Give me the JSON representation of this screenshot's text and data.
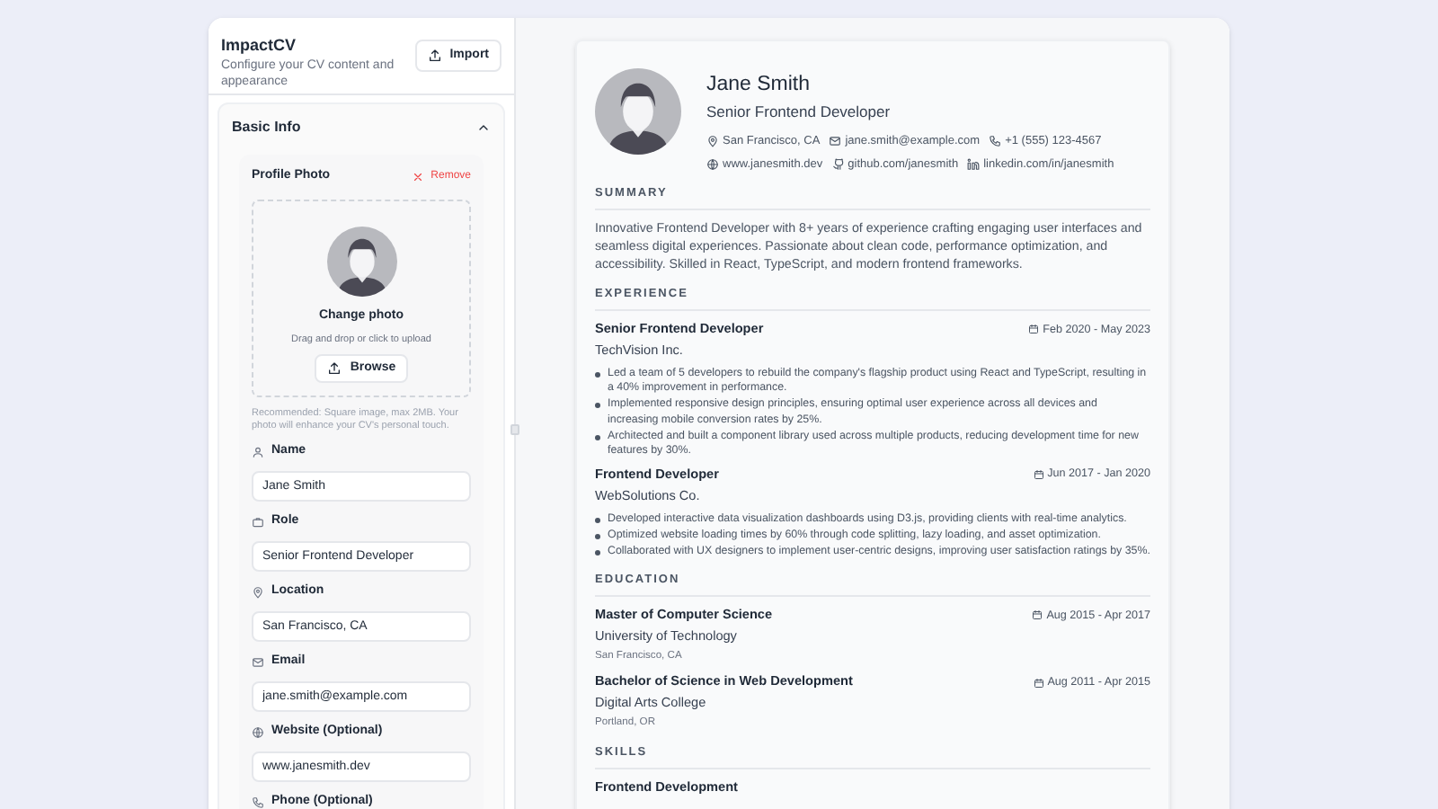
{
  "editor": {
    "title": "ImpactCV",
    "subtitle": "Configure your CV content and appearance",
    "import_button": "Import"
  },
  "basic_info": {
    "title": "Basic Info",
    "expanded": true,
    "photo": {
      "title": "Profile Photo",
      "remove": "Remove",
      "change": "Change photo",
      "hint": "Drag and drop or click to upload",
      "browse": "Browse",
      "note": "Recommended: Square image, max 2MB. Your photo will enhance your CV's personal touch."
    },
    "fields": [
      {
        "kind": "name",
        "label": "Name",
        "value": "Jane Smith"
      },
      {
        "kind": "role",
        "label": "Role",
        "value": "Senior Frontend Developer"
      },
      {
        "kind": "location",
        "label": "Location",
        "value": "San Francisco, CA"
      },
      {
        "kind": "email",
        "label": "Email",
        "value": "jane.smith@example.com"
      },
      {
        "kind": "website",
        "label": "Website (Optional)",
        "value": "www.janesmith.dev"
      },
      {
        "kind": "phone",
        "label": "Phone (Optional)"
      }
    ]
  },
  "resume": {
    "name": "Jane Smith",
    "role": "Senior Frontend Developer",
    "contacts": [
      {
        "kind": "location",
        "text": "San Francisco, CA"
      },
      {
        "kind": "email",
        "text": "jane.smith@example.com"
      },
      {
        "kind": "phone",
        "text": "+1 (555) 123-4567"
      },
      {
        "kind": "website",
        "text": "www.janesmith.dev"
      },
      {
        "kind": "github",
        "text": "github.com/janesmith"
      },
      {
        "kind": "linkedin",
        "text": "linkedin.com/in/janesmith"
      }
    ],
    "summary": {
      "heading": "SUMMARY",
      "text": "Innovative Frontend Developer with 8+ years of experience crafting engaging user interfaces and seamless digital experiences. Passionate about clean code, performance optimization, and accessibility. Skilled in React, TypeScript, and modern frontend frameworks."
    },
    "experience": {
      "heading": "EXPERIENCE",
      "items": [
        {
          "title": "Senior Frontend Developer",
          "company": "TechVision Inc.",
          "dates": "Feb 2020 - May 2023",
          "bullets": [
            "Led a team of 5 developers to rebuild the company's flagship product using React and TypeScript, resulting in a 40% improvement in performance.",
            "Implemented responsive design principles, ensuring optimal user experience across all devices and increasing mobile conversion rates by 25%.",
            "Architected and built a component library used across multiple products, reducing development time for new features by 30%."
          ]
        },
        {
          "title": "Frontend Developer",
          "company": "WebSolutions Co.",
          "dates": "Jun 2017 - Jan 2020",
          "bullets": [
            "Developed interactive data visualization dashboards using D3.js, providing clients with real-time analytics.",
            "Optimized website loading times by 60% through code splitting, lazy loading, and asset optimization.",
            "Collaborated with UX designers to implement user-centric designs, improving user satisfaction ratings by 35%."
          ]
        }
      ]
    },
    "education": {
      "heading": "EDUCATION",
      "items": [
        {
          "degree": "Master of Computer Science",
          "school": "University of Technology",
          "location": "San Francisco, CA",
          "dates": "Aug 2015 - Apr 2017"
        },
        {
          "degree": "Bachelor of Science in Web Development",
          "school": "Digital Arts College",
          "location": "Portland, OR",
          "dates": "Aug 2011 - Apr 2015"
        }
      ]
    },
    "skills": {
      "heading": "SKILLS",
      "groups": [
        {
          "title": "Frontend Development"
        }
      ]
    }
  }
}
